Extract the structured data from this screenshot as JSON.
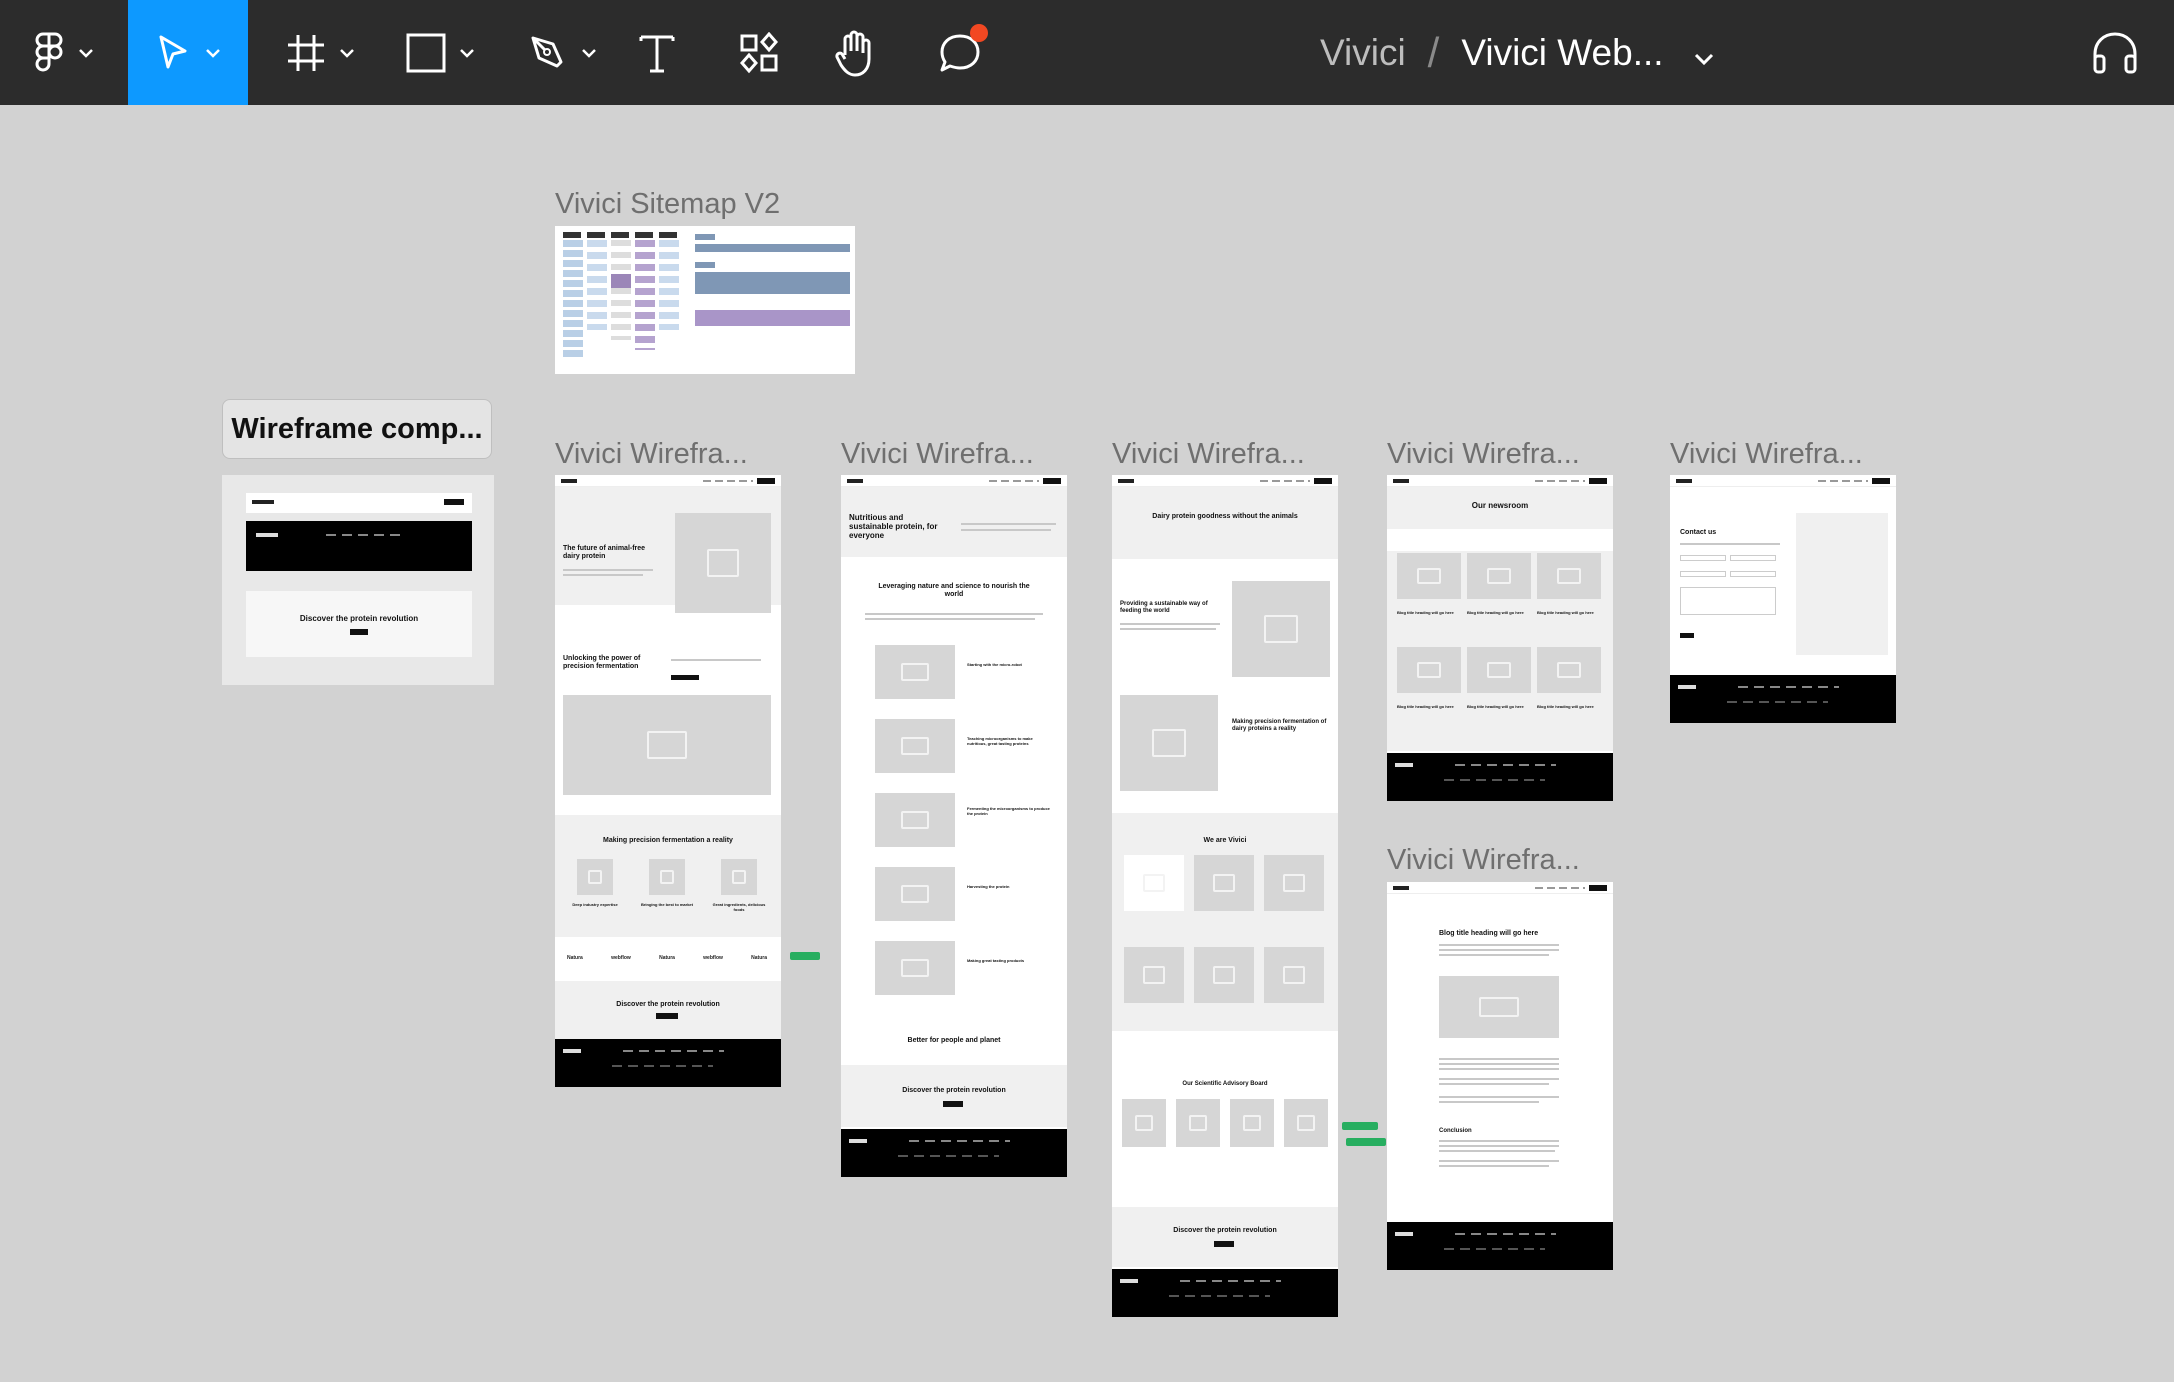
{
  "toolbar": {
    "tools": [
      {
        "name": "figma-menu",
        "icon": "figma-logo-icon"
      },
      {
        "name": "move-tool",
        "icon": "cursor-icon",
        "active": true
      },
      {
        "name": "frame-tool",
        "icon": "frame-hash-icon"
      },
      {
        "name": "shape-tool",
        "icon": "rectangle-icon"
      },
      {
        "name": "pen-tool",
        "icon": "pen-icon"
      },
      {
        "name": "text-tool",
        "icon": "text-icon"
      },
      {
        "name": "resources-tool",
        "icon": "components-icon"
      },
      {
        "name": "hand-tool",
        "icon": "hand-icon"
      },
      {
        "name": "comment-tool",
        "icon": "comment-icon",
        "badge_color": "#f24822"
      }
    ],
    "accent": "#0d99ff"
  },
  "breadcrumb": {
    "team": "Vivici",
    "separator": "/",
    "file": "Vivici Web..."
  },
  "canvas": {
    "chip_label": "Wireframe comp...",
    "sitemap_label": "Vivici Sitemap V2",
    "frames": [
      {
        "label": "Vivici Wirefra..."
      },
      {
        "label": "Vivici Wirefra..."
      },
      {
        "label": "Vivici Wirefra..."
      },
      {
        "label": "Vivici Wirefra..."
      },
      {
        "label": "Vivici Wirefra..."
      },
      {
        "label": "Vivici Wirefra..."
      }
    ],
    "home": {
      "hero_title": "The future of animal-free dairy protein",
      "section2_title": "Unlocking the power of precision fermentation",
      "section3_title": "Making precision fermentation a reality",
      "cols": [
        "Deep industry expertise",
        "Bringing the best to market",
        "Great ingredients, delicious foods"
      ],
      "cta_title": "Discover the protein revolution",
      "logos": [
        "Natura",
        "webflow",
        "Natura",
        "webflow",
        "Natura"
      ]
    },
    "about": {
      "hero_title": "Nutritious and sustainable protein, for everyone",
      "section_title": "Leveraging nature and science to nourish the world",
      "steps": [
        "Starting with the micro-robot",
        "Teaching microorganisms to make nutritious, great tasting proteins",
        "Fermenting the microorganisms to produce the protein",
        "Harvesting the protein",
        "Making great tasting products"
      ],
      "bottom_title": "Better for people and planet",
      "cta_title": "Discover the protein revolution"
    },
    "team": {
      "hero_title": "Dairy protein goodness without the animals",
      "s1_title": "Providing a sustainable way of feeding the world",
      "s2_title": "Making precision fermentation of dairy proteins a reality",
      "team_title": "We are Vivici",
      "advisory_title": "Our Scientific Advisory Board",
      "cta_title": "Discover the protein revolution"
    },
    "news": {
      "title": "Our newsroom",
      "card_title": "Blog title heading will go here"
    },
    "contact": {
      "title": "Contact us"
    },
    "blog": {
      "title": "Blog title heading will go here",
      "conclusion": "Conclusion"
    },
    "component": {
      "cta_title": "Discover the protein revolution"
    },
    "connector_color": "#27ae60"
  }
}
